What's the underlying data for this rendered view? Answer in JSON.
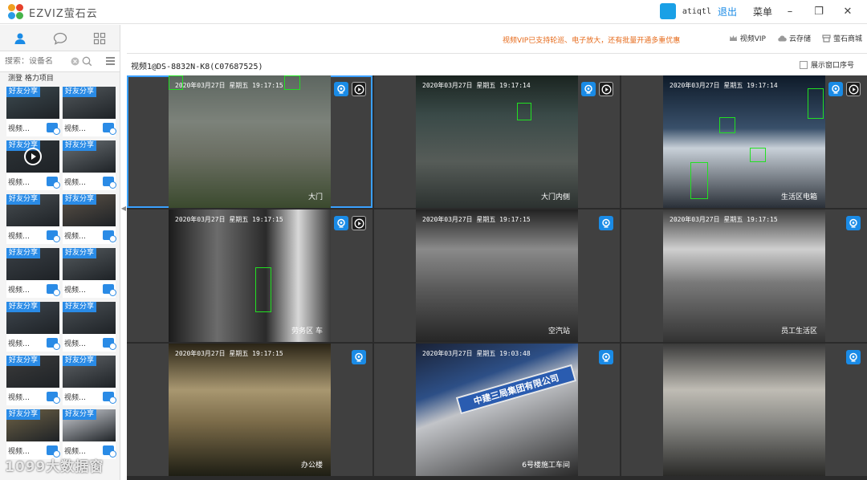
{
  "app": {
    "title": "EZVIZ萤石云"
  },
  "titlebar": {
    "username": "atiqtl",
    "logout": "退出",
    "menu": "菜单",
    "minimize": "–",
    "restore": "❐",
    "close": "✕"
  },
  "sidebar": {
    "search_placeholder": "搜索：设备名",
    "group_label": "测登  格力项目",
    "share_tag": "好友分享",
    "thumb_label": "视频…",
    "thumb_count": 14
  },
  "topbar": {
    "promo": "视频VIP已支持轮巡、电子放大，还有批量开通多重优惠",
    "vip": "视频VIP",
    "cloud": "云存储",
    "mall": "萤石商城"
  },
  "channel": {
    "title": "视频1@DS-8832N-K8(C07687525)",
    "show_index_label": "展示窗口序号"
  },
  "cells": [
    {
      "osd": "2020年03月27日  星期五  19:17:15",
      "caption": "大门",
      "selected": true,
      "has_play": true
    },
    {
      "osd": "2020年03月27日  星期五  19:17:14",
      "caption": "大门内侧",
      "selected": false,
      "has_play": true
    },
    {
      "osd": "2020年03月27日  星期五  19:17:14",
      "caption": "生活区电箱",
      "selected": false,
      "has_play": true
    },
    {
      "osd": "2020年03月27日  星期五  19:17:15",
      "caption": "劳务区  车",
      "selected": false,
      "has_play": true
    },
    {
      "osd": "2020年03月27日  星期五  19:17:15",
      "caption": "空汽站",
      "selected": false,
      "has_play": false
    },
    {
      "osd": "2020年03月27日  星期五  19:17:15",
      "caption": "员工生活区",
      "selected": false,
      "has_play": false
    },
    {
      "osd": "2020年03月27日  星期五  19:17:15",
      "caption": "办公楼",
      "selected": false,
      "has_play": false
    },
    {
      "osd": "2020年03月27日  星期五  19:03:48",
      "caption": "6号楼施工车间",
      "selected": false,
      "has_play": false
    },
    {
      "osd": "",
      "caption": "",
      "selected": false,
      "has_play": false
    }
  ],
  "sign": {
    "company": "中建三局集团有限公司"
  },
  "watermark": "1099大数据窗"
}
